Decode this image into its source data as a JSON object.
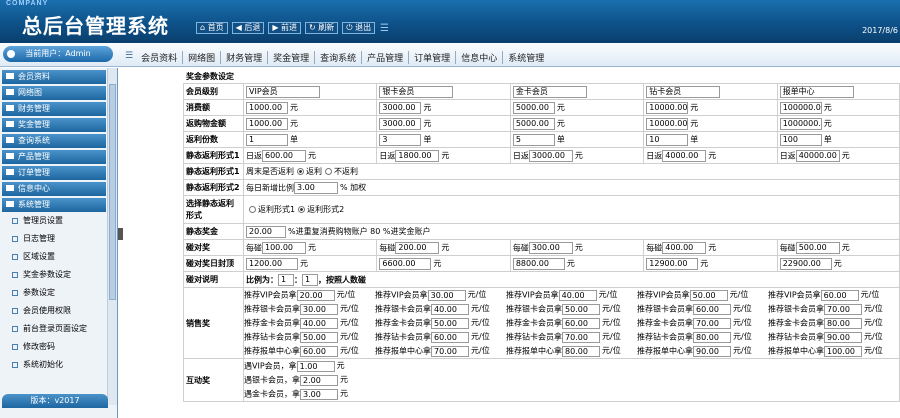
{
  "header": {
    "company": "COMPANY",
    "title": "总后台管理系统",
    "nav": [
      "首页",
      "后退",
      "前进",
      "刷新",
      "退出"
    ],
    "date": "2017/8/6"
  },
  "user": {
    "label": "当前用户：Admin"
  },
  "menu_tabs": [
    "会员资料",
    "网络图",
    "财务管理",
    "奖金管理",
    "查询系统",
    "产品管理",
    "订单管理",
    "信息中心",
    "系统管理"
  ],
  "sidebar": {
    "items": [
      "会员资料",
      "网络图",
      "财务管理",
      "奖金管理",
      "查询系统",
      "产品管理",
      "订单管理",
      "信息中心",
      "系统管理"
    ],
    "subitems": [
      "管理员设置",
      "日志管理",
      "区域设置",
      "奖金参数设定",
      "参数设定",
      "会员使用权限",
      "前台登录页面设定",
      "修改密码",
      "系统初始化"
    ],
    "version": "版本：v2017"
  },
  "page": {
    "caption": "奖金参数设定",
    "level": {
      "label": "会员级别",
      "values": [
        "VIP会员",
        "银卡会员",
        "金卡会员",
        "钻卡会员",
        "报单中心"
      ]
    },
    "consume": {
      "label": "消费额",
      "values": [
        "1000.00",
        "3000.00",
        "5000.00",
        "10000.00",
        "100000.00"
      ],
      "unit": "元"
    },
    "repurchase": {
      "label": "返购物金额",
      "values": [
        "1000.00",
        "3000.00",
        "5000.00",
        "10000.00",
        "1000000.00"
      ],
      "unit": "元"
    },
    "shares": {
      "label": "返利份数",
      "values": [
        "1",
        "3",
        "5",
        "10",
        "100"
      ],
      "unit": "单"
    },
    "form1": {
      "label": "静态返利形式1",
      "prefix": "日返",
      "values": [
        "600.00",
        "1800.00",
        "3000.00",
        "4000.00",
        "40000.00"
      ],
      "unit": "元"
    },
    "form1b": {
      "label": "静态返利形式1",
      "text": "周末是否返利",
      "opt_yes": "返利",
      "opt_no": "不返利"
    },
    "form2": {
      "label": "静态返利形式2",
      "text": "每日新增比例",
      "value": "3.00",
      "suffix": "%  加权"
    },
    "choose": {
      "label": "选择静态返利形式",
      "opt1": "返利形式1",
      "opt2": "返利形式2"
    },
    "static": {
      "label": "静态奖金",
      "value": "20.00",
      "text": "%进重复消费购物账户  80  %进奖金账户"
    },
    "pair": {
      "label": "碰对奖",
      "prefix": "每碰",
      "values": [
        "100.00",
        "200.00",
        "300.00",
        "400.00",
        "500.00"
      ],
      "unit": "元"
    },
    "pairtop": {
      "label": "碰对奖日封顶",
      "values": [
        "1200.00",
        "6600.00",
        "8800.00",
        "12900.00",
        "22900.00"
      ],
      "unit": "元"
    },
    "pairnote": {
      "label": "碰对说明",
      "text1": "比例为：",
      "v1": "1",
      "colon": "：",
      "v2": "1",
      "text2": "，按照人数碰"
    },
    "sales": {
      "label": "销售奖",
      "rows": [
        "推荐VIP会员拿",
        "推荐银卡会员拿",
        "推荐金卡会员拿",
        "推荐钻卡会员拿",
        "推荐报单中心拿"
      ],
      "unit": "元/位",
      "values": [
        [
          "20.00",
          "30.00",
          "40.00",
          "50.00",
          "60.00"
        ],
        [
          "30.00",
          "40.00",
          "50.00",
          "60.00",
          "70.00"
        ],
        [
          "40.00",
          "50.00",
          "60.00",
          "70.00",
          "80.00"
        ],
        [
          "50.00",
          "60.00",
          "70.00",
          "80.00",
          "90.00"
        ],
        [
          "60.00",
          "70.00",
          "80.00",
          "90.00",
          "100.00"
        ]
      ]
    },
    "mutual": {
      "label": "互动奖",
      "rows": [
        "遇VIP会员，拿",
        "遇银卡会员，拿",
        "遇金卡会员，拿"
      ],
      "values": [
        "1.00",
        "2.00",
        "3.00"
      ],
      "unit": "元"
    }
  }
}
